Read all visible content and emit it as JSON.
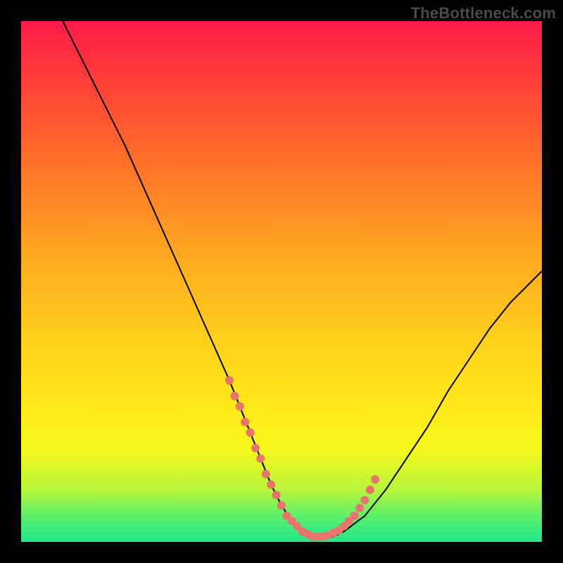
{
  "watermark": "TheBottleneck.com",
  "colors": {
    "frame": "#000000",
    "curve": "#000000",
    "marker": "#e8746b",
    "gradient_top": "#ff1a4a",
    "gradient_bottom": "#20e88a"
  },
  "chart_data": {
    "type": "line",
    "title": "",
    "xlabel": "",
    "ylabel": "",
    "xlim": [
      0,
      100
    ],
    "ylim": [
      0,
      100
    ],
    "grid": false,
    "legend": false,
    "series": [
      {
        "name": "curve",
        "x": [
          8,
          12,
          16,
          20,
          24,
          28,
          32,
          36,
          40,
          44,
          46,
          48,
          50,
          52,
          54,
          56,
          58,
          60,
          62,
          66,
          70,
          74,
          78,
          82,
          86,
          90,
          94,
          98,
          100
        ],
        "y": [
          100,
          92,
          84,
          76,
          67,
          58,
          49,
          40,
          31,
          21,
          16,
          11,
          7,
          4,
          2,
          1,
          1,
          1,
          2,
          5,
          10,
          16,
          22,
          29,
          35,
          41,
          46,
          50,
          52
        ]
      }
    ],
    "markers": {
      "name": "highlight-dots",
      "x": [
        40,
        41,
        42,
        43,
        44,
        45,
        46,
        47,
        48,
        49,
        50,
        51,
        52,
        53,
        54,
        55,
        56,
        57,
        58,
        59,
        60,
        61,
        62,
        63,
        64,
        65,
        66,
        67,
        68
      ],
      "y": [
        31,
        28,
        26,
        23,
        21,
        18,
        16,
        13,
        11,
        9,
        7,
        5,
        4,
        3,
        2,
        1.5,
        1,
        1,
        1,
        1.3,
        1.7,
        2.2,
        3,
        4,
        5,
        6.5,
        8,
        10,
        12
      ]
    }
  }
}
